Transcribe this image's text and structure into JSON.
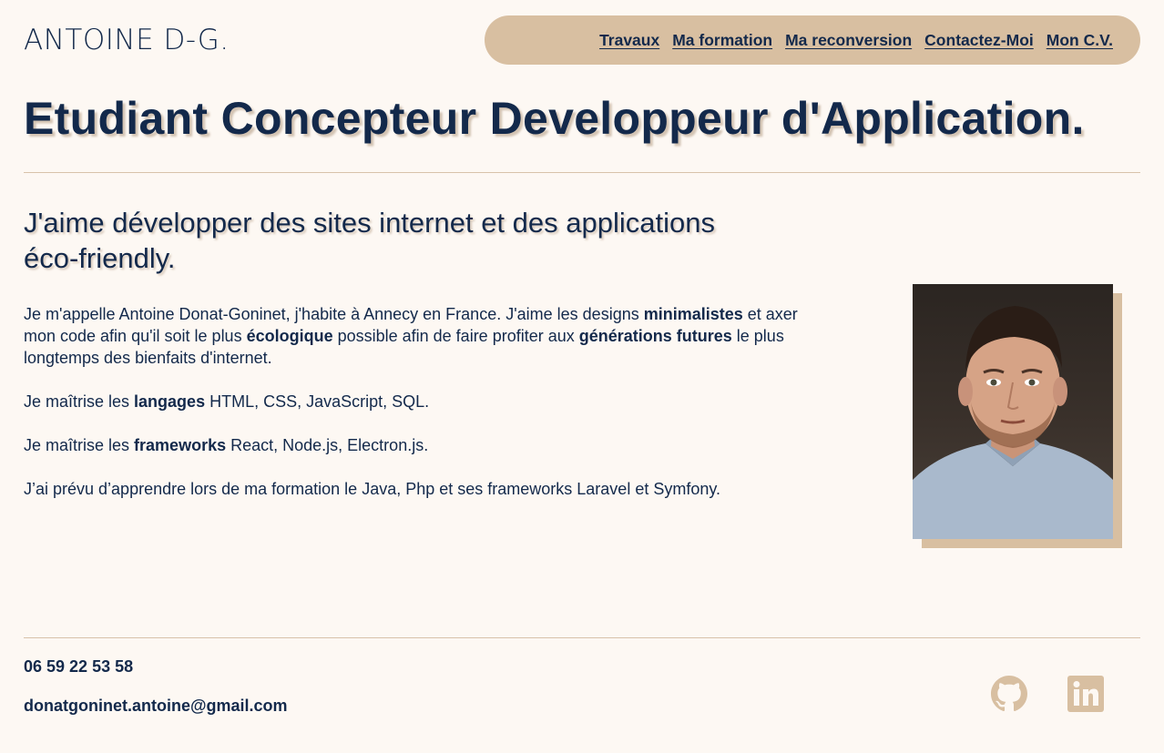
{
  "header": {
    "logo": "ANTOINE D-G.",
    "nav": [
      {
        "label": "Travaux"
      },
      {
        "label": "Ma formation"
      },
      {
        "label": "Ma reconversion"
      },
      {
        "label": "Contactez-Moi"
      },
      {
        "label": "Mon C.V."
      }
    ]
  },
  "hero": {
    "title": "Etudiant Concepteur Developpeur d'Application."
  },
  "about": {
    "subtitle": "J'aime développer des sites internet et des applications éco-friendly.",
    "p1": {
      "t1": "Je m'appelle Antoine Donat-Goninet, j'habite à Annecy en France. J'aime les designs ",
      "b1": "minimalistes",
      "t2": " et axer mon code afin qu'il soit le plus ",
      "b2": "écologique",
      "t3": " possible afin de faire profiter aux ",
      "b3": "générations futures",
      "t4": " le plus longtemps des bienfaits d'internet."
    },
    "p2": {
      "t1": "Je maîtrise les ",
      "b1": "langages",
      "t2": " HTML, CSS, JavaScript, SQL."
    },
    "p3": {
      "t1": "Je maîtrise les ",
      "b1": "frameworks",
      "t2": " React, Node.js, Electron.js."
    },
    "p4": "J’ai prévu d’apprendre lors de ma formation le Java, Php et ses frameworks Laravel et Symfony."
  },
  "footer": {
    "phone": "06 59 22 53 58",
    "email": "donatgoninet.antoine@gmail.com",
    "icons": [
      "github-icon",
      "linkedin-icon"
    ]
  },
  "colors": {
    "background": "#fdf8f3",
    "text": "#13294b",
    "accent": "#d8bfa1"
  }
}
